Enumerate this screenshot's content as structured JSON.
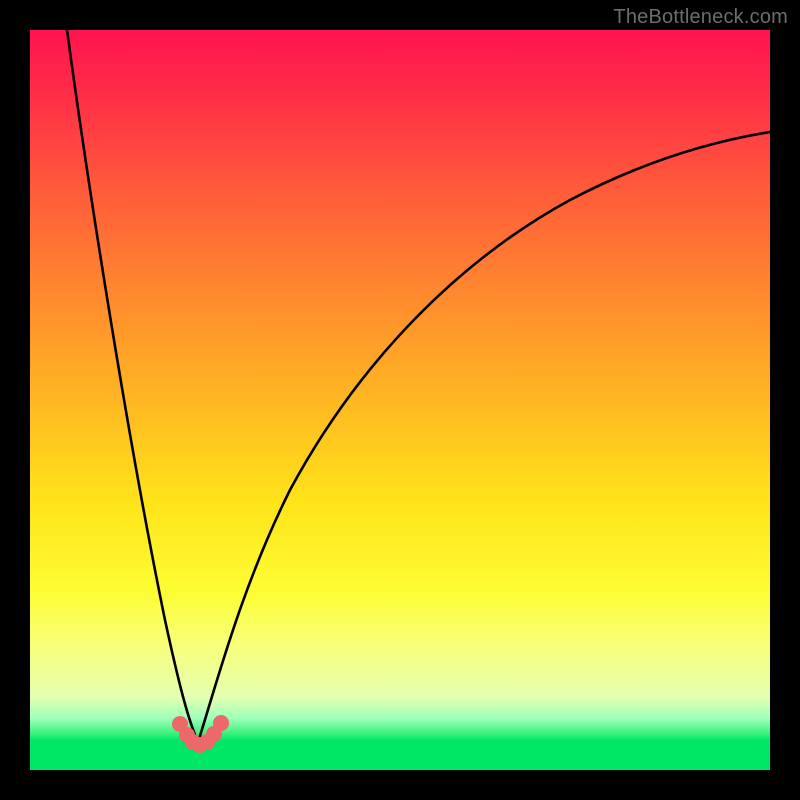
{
  "watermark": "TheBottleneck.com",
  "colors": {
    "page_bg": "#000000",
    "gradient_top": "#ff1450",
    "gradient_mid": "#ffe41a",
    "gradient_bottom": "#00e765",
    "curve": "#000000",
    "marker": "#ed6869"
  },
  "chart_data": {
    "type": "line",
    "title": "",
    "xlabel": "",
    "ylabel": "",
    "xlim": [
      0,
      100
    ],
    "ylim": [
      0,
      100
    ],
    "optimum_x": 22,
    "series": [
      {
        "name": "left-branch",
        "x": [
          5,
          7,
          9,
          11,
          13,
          15,
          17,
          19,
          20,
          21,
          22
        ],
        "values": [
          100,
          82,
          66,
          52,
          41,
          31,
          22,
          13,
          8,
          4,
          0
        ]
      },
      {
        "name": "right-branch",
        "x": [
          22,
          24,
          26,
          28,
          31,
          35,
          40,
          46,
          53,
          61,
          70,
          80,
          90,
          100
        ],
        "values": [
          0,
          6,
          12,
          18,
          26,
          35,
          44,
          52,
          59,
          66,
          71,
          76,
          80,
          84
        ]
      }
    ],
    "markers": {
      "name": "optimum-band",
      "x": [
        19.5,
        20.5,
        21.5,
        22.0,
        22.5,
        23.5,
        24.5
      ],
      "values": [
        5.0,
        2.8,
        1.2,
        0.8,
        1.2,
        2.8,
        5.0
      ]
    }
  }
}
